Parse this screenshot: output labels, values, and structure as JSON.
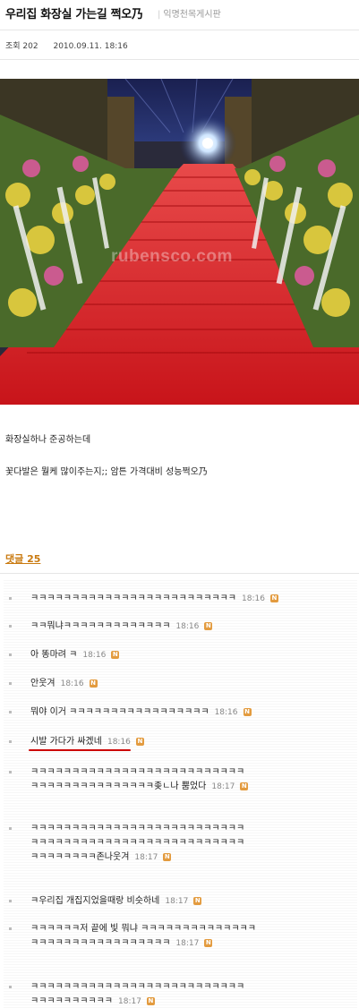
{
  "post": {
    "title": "우리집 화장실 가는길 쩍오乃",
    "board": "익명천목게시판",
    "views": "조회 202",
    "date": "2010.09.11. 18:16",
    "watermark": "rubensco.com",
    "body_lines": [
      "화장실하나 준공하는데",
      "꽃다발은 뭘케 많이주는지;; 암튼 가격대비 성능쩍오乃"
    ]
  },
  "comments": {
    "label": "댓글 25",
    "new_badge": "N",
    "items": [
      {
        "lines": [
          "ㅋㅋㅋㅋㅋㅋㅋㅋㅋㅋㅋㅋㅋㅋㅋㅋㅋㅋㅋㅋㅋㅋㅋㅋㅋ"
        ],
        "time": "18:16"
      },
      {
        "lines": [
          "ㅋㅋ뭐냐ㅋㅋㅋㅋㅋㅋㅋㅋㅋㅋㅋㅋㅋ"
        ],
        "time": "18:16"
      },
      {
        "lines": [
          "아 똥마려 ㅋ"
        ],
        "time": "18:16"
      },
      {
        "lines": [
          "안웃겨"
        ],
        "time": "18:16"
      },
      {
        "lines": [
          "뭐야 이거 ㅋㅋㅋㅋㅋㅋㅋㅋㅋㅋㅋㅋㅋㅋㅋㅋㅋ"
        ],
        "time": "18:16"
      },
      {
        "lines": [
          "시발 가다가 싸겠네"
        ],
        "time": "18:16"
      },
      {
        "lines": [
          "ㅋㅋㅋㅋㅋㅋㅋㅋㅋㅋㅋㅋㅋㅋㅋㅋㅋㅋㅋㅋㅋㅋㅋㅋㅋㅋ",
          "ㅋㅋㅋㅋㅋㅋㅋㅋㅋㅋㅋㅋㅋㅋㅋ좆ㄴ나 뿜었다"
        ],
        "time": "18:17"
      },
      {
        "lines": [
          "ㅋㅋㅋㅋㅋㅋㅋㅋㅋㅋㅋㅋㅋㅋㅋㅋㅋㅋㅋㅋㅋㅋㅋㅋㅋㅋ",
          "ㅋㅋㅋㅋㅋㅋㅋㅋㅋㅋㅋㅋㅋㅋㅋㅋㅋㅋㅋㅋㅋㅋㅋㅋㅋㅋ",
          "ㅋㅋㅋㅋㅋㅋㅋㅋ존나웃겨"
        ],
        "time": "18:17"
      },
      {
        "lines": [
          "ㅋ우리집 개집지었을때랑 비슷하네"
        ],
        "time": "18:17"
      },
      {
        "lines": [
          "ㅋㅋㅋㅋㅋㅋ저 끝에 빛 뭐냐 ㅋㅋㅋㅋㅋㅋㅋㅋㅋㅋㅋㅋㅋㅋ",
          "ㅋㅋㅋㅋㅋㅋㅋㅋㅋㅋㅋㅋㅋㅋㅋㅋㅋ"
        ],
        "time": "18:17"
      },
      {
        "lines": [
          "ㅋㅋㅋㅋㅋㅋㅋㅋㅋㅋㅋㅋㅋㅋㅋㅋㅋㅋㅋㅋㅋㅋㅋㅋㅋㅋ",
          "ㅋㅋㅋㅋㅋㅋㅋㅋㅋㅋ"
        ],
        "time": "18:17"
      }
    ]
  },
  "colors": {
    "comment_label": "#c97a10",
    "badge": "#e39b3f",
    "carpet": "#d01a1f",
    "highlight_underline": "#cc0000"
  }
}
